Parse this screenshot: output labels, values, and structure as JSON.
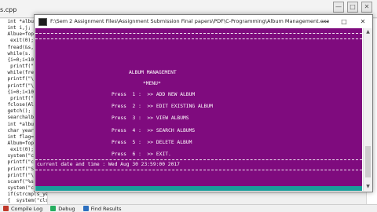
{
  "ide": {
    "file_tab": "s.cpp",
    "code_lines": [
      "  int *albue;",
      "  int i,j;",
      "  Albue=fopen(\"",
      "   exit(0);",
      "  fread(&s,",
      "  while(s.",
      "  {i=0;i<10;i++",
      "   printf(\"-\");",
      "",
      "  while(fread(&s,sizeof",
      "",
      "  printf(\"\\n  %",
      "",
      "  printf(\"\\n\");",
      "  {i=0;i<10;i++",
      "   printf(\"-\");",
      "",
      "  fclose(Album);",
      "  getch();",
      "",
      "  searchalbum()",
      "",
      "  int *albue;",
      "  char year[20];",
      "  int flag=1;",
      "  Album=fopen(\"Album",
      "   exit(0);",
      "  system(\"cls\");",
      "  printf(\"cls\");",
      "  printf(\"SEARCH \"",
      "  printf(\"\\nEnter A",
      "  scanf(\"%s\", year",
      "  system(\"cls\");",
      "",
      "  if(strcmp(s_year,year)==0)",
      "  {  system(\"cls\");"
    ],
    "window_controls": [
      "—",
      "□",
      "✕"
    ],
    "status_items": [
      {
        "label": "Compile Log",
        "icon": "compile-log-icon",
        "color": "#c0392b"
      },
      {
        "label": "Debug",
        "icon": "debug-icon",
        "color": "#27ae60"
      },
      {
        "label": "Find Results",
        "icon": "find-results-icon",
        "color": "#2c6fbf"
      }
    ]
  },
  "console": {
    "title": "F:\\Sem 2 Assignment Files\\Assignment Submission Final papers\\PDF\\C-Programming\\Album Management.exe",
    "bg_color": "#7f0b7e",
    "strip_color": "#1a9e9a",
    "controls": [
      "—",
      "□",
      "✕"
    ],
    "heading": "ALBUM MANAGEMENT",
    "menu_label": "*MENU*",
    "menu_items": [
      "Press  1 :  >> ADD NEW ALBUM",
      "Press  2 :  >> EDIT EXISTING ALBUM",
      "Press  3 :  >> VIEW ALBUMS",
      "Press  4 :  >> SEARCH ALBUMS",
      "Press  5 :  >> DELETE ALBUM",
      "Press  6 :  >> EXIT."
    ],
    "datetime_line": "current date and time : Wed Aug 30 23:59:00 2017"
  }
}
